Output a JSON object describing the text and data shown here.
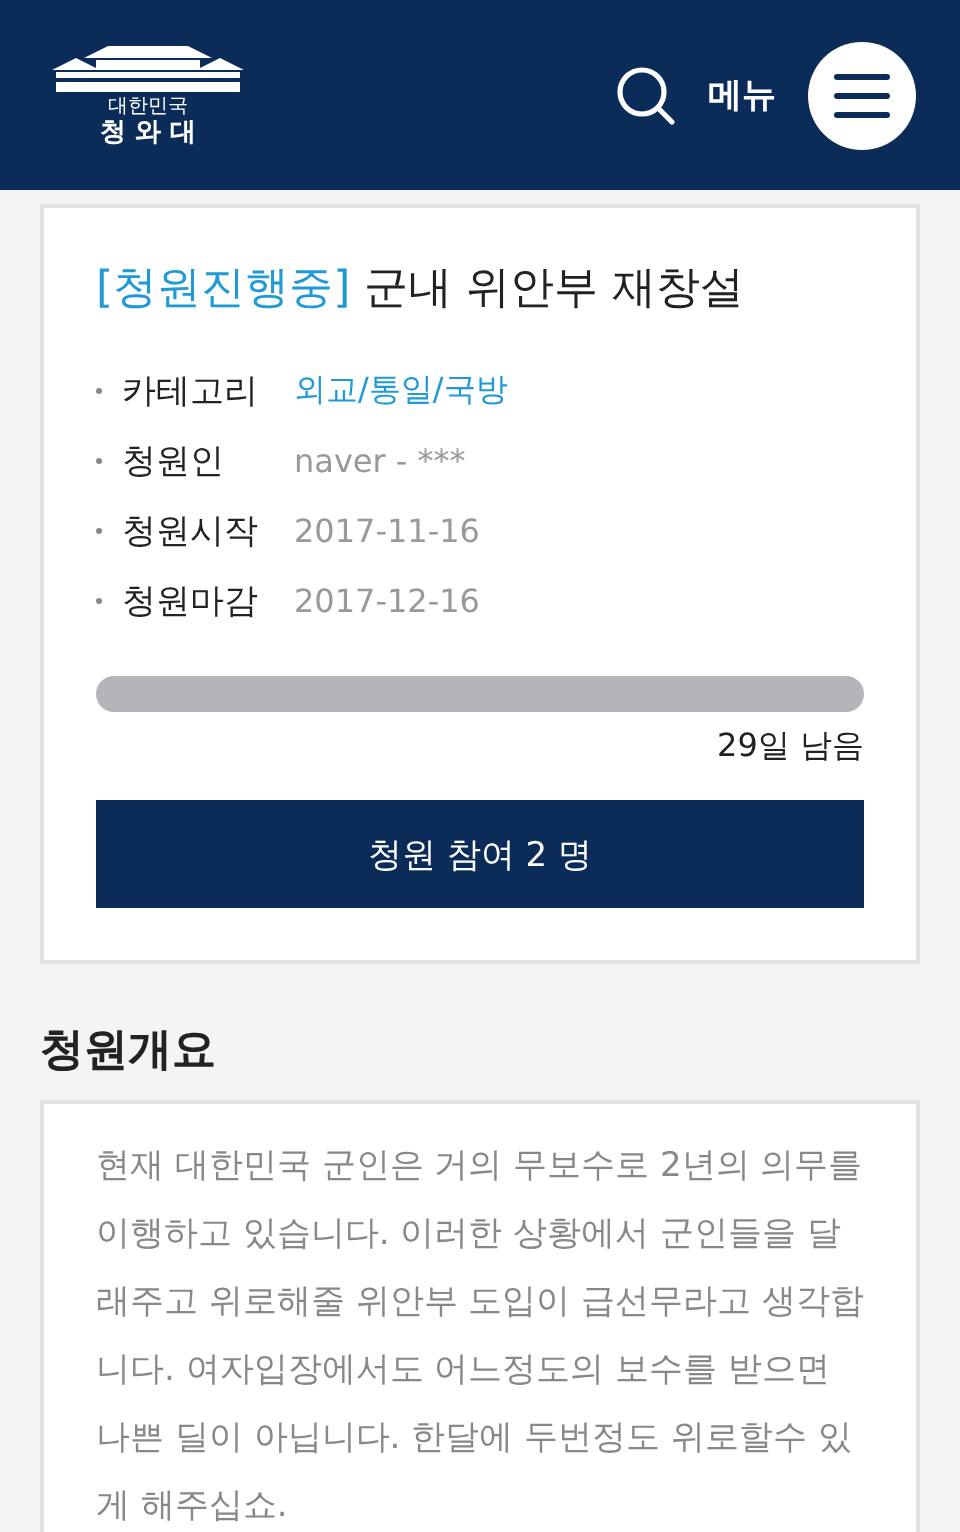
{
  "header": {
    "logo_small": "대한민국",
    "logo_name": "청 와 대",
    "menu_label": "메뉴"
  },
  "petition": {
    "status": "[청원진행중]",
    "title": "군내 위안부 재창설",
    "details": [
      {
        "label": "카테고리",
        "value": "외교/통일/국방",
        "kind": "link"
      },
      {
        "label": "청원인",
        "value": "naver - ***",
        "kind": "text"
      },
      {
        "label": "청원시작",
        "value": "2017-11-16",
        "kind": "text"
      },
      {
        "label": "청원마감",
        "value": "2017-12-16",
        "kind": "text"
      }
    ],
    "progress": {
      "level": 0
    },
    "remaining": "29일 남음",
    "join_button": "청원 참여 2 명"
  },
  "summary": {
    "heading": "청원개요",
    "text": "현재 대한민국 군인은 거의 무보수로 2년의 의무를 이행하고 있습니다. 이러한 상황에서 군인들을 달래주고 위로해줄 위안부 도입이 급선무라고 생각합니다. 여자입장에서도 어느정도의 보수를 받으면 나쁜 딜이 아닙니다. 한달에 두번정도 위로할수 있게 해주십쇼."
  }
}
